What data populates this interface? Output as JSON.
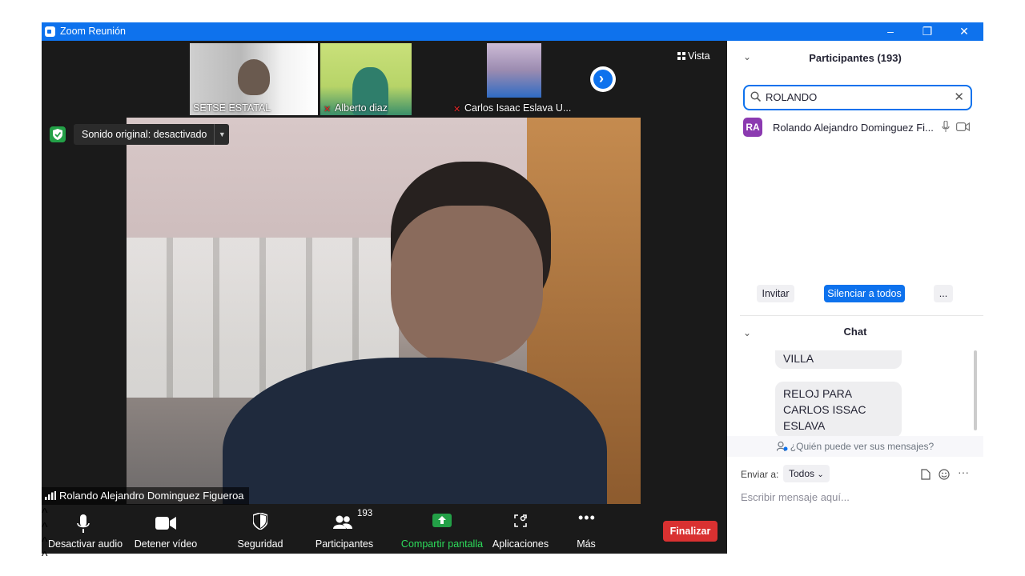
{
  "window": {
    "title": "Zoom Reunión",
    "controls": {
      "minimize": "–",
      "restore": "❐",
      "close": "✕"
    }
  },
  "thumbnails": [
    {
      "name": "SETSE ESTATAL",
      "muted": false
    },
    {
      "name": "Alberto diaz",
      "muted": true
    },
    {
      "name": "Carlos Isaac Eslava U...",
      "muted": true
    }
  ],
  "view_label": "Vista",
  "audio_banner": "Sonido original: desactivado",
  "active_speaker": "Rolando Alejandro Dominguez Figueroa",
  "toolbar": {
    "mute": "Desactivar audio",
    "video": "Detener vídeo",
    "security": "Seguridad",
    "participants": "Participantes",
    "participants_count": "193",
    "share": "Compartir pantalla",
    "apps": "Aplicaciones",
    "more": "Más",
    "end": "Finalizar"
  },
  "participants_panel": {
    "title": "Participantes (193)",
    "search_value": "ROLANDO",
    "results": [
      {
        "initials": "RA",
        "name": "Rolando Alejandro Dominguez Fi..."
      }
    ],
    "invite": "Invitar",
    "mute_all": "Silenciar a todos",
    "more": "..."
  },
  "chat": {
    "title": "Chat",
    "messages": [
      "VILLA",
      "RELOJ PARA CARLOS ISSAC ESLAVA"
    ],
    "who_can_see": "¿Quién puede ver sus mensajes?",
    "send_to_label": "Enviar a:",
    "send_to_value": "Todos",
    "input_placeholder": "Escribir mensaje aquí..."
  },
  "colors": {
    "zoom_blue": "#0e72ed",
    "end_red": "#d93131",
    "share_green": "#23a047",
    "avatar_purple": "#8b3ab0"
  }
}
